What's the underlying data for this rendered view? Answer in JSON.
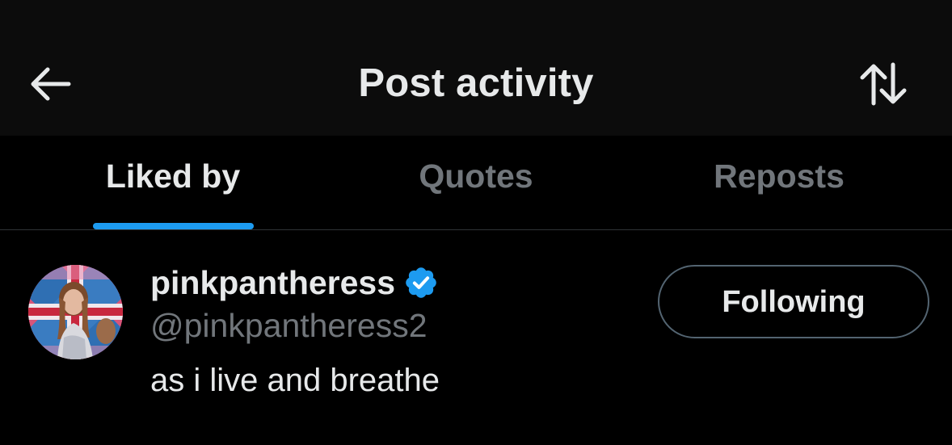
{
  "header": {
    "title": "Post activity",
    "back_icon": "arrow-left-icon",
    "sort_icon": "sort-arrows-icon"
  },
  "tabs": [
    {
      "label": "Liked by",
      "active": true
    },
    {
      "label": "Quotes",
      "active": false
    },
    {
      "label": "Reposts",
      "active": false
    }
  ],
  "user": {
    "display_name": "pinkpantheress",
    "handle": "@pinkpantheress2",
    "bio": "as i live and breathe",
    "verified": true,
    "follow_label": "Following"
  },
  "colors": {
    "background": "#000000",
    "header_background": "#0c0c0c",
    "primary_text": "#e7e9ea",
    "secondary_text": "#71767b",
    "accent": "#1d9bf0",
    "divider": "#2f3336"
  }
}
